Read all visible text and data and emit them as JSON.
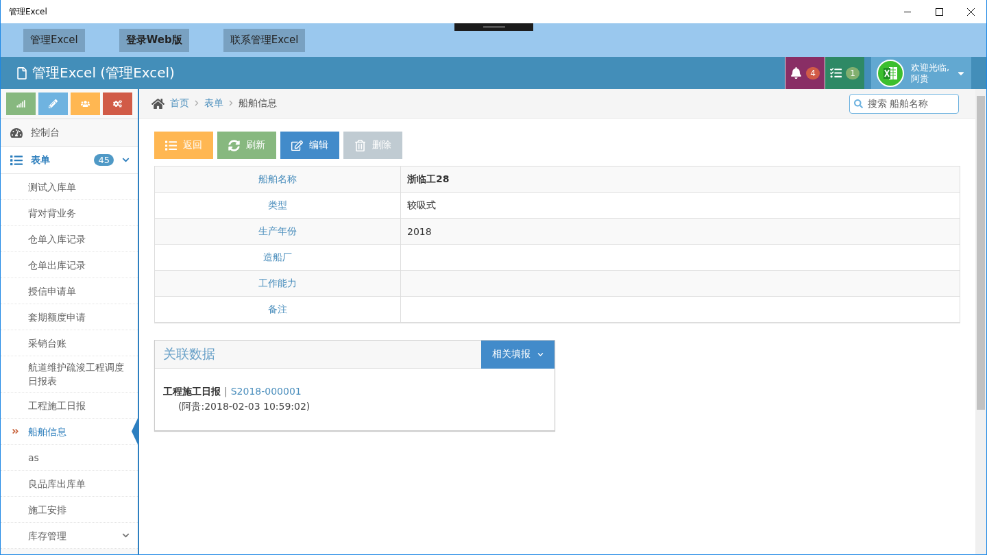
{
  "window": {
    "title": "管理Excel"
  },
  "top_nav": [
    {
      "label": "管理Excel",
      "selected": false
    },
    {
      "label": "登录Web版",
      "selected": true
    },
    {
      "label": "联系管理Excel",
      "selected": false
    }
  ],
  "header": {
    "title": "管理Excel (管理Excel)",
    "notifications": "4",
    "tasks": "1",
    "user": {
      "greeting": "欢迎光临,",
      "name": "阿贵"
    }
  },
  "sidebar": {
    "shortcuts": [
      {
        "kind": "chart",
        "color": "#87b87f"
      },
      {
        "kind": "pencil",
        "color": "#6fb3e0"
      },
      {
        "kind": "users",
        "color": "#ffb752"
      },
      {
        "kind": "cogs",
        "color": "#d15b47"
      }
    ],
    "menu": [
      {
        "label": "控制台",
        "kind": "dashboard",
        "expanded": false
      },
      {
        "label": "表单",
        "kind": "list",
        "badge": "45",
        "expanded": true,
        "children": [
          {
            "label": "测试入库单",
            "kind": "link",
            "selected": false
          },
          {
            "label": "背对背业务",
            "kind": "link",
            "selected": false
          },
          {
            "label": "仓单入库记录",
            "kind": "link",
            "selected": false
          },
          {
            "label": "仓单出库记录",
            "kind": "link",
            "selected": false
          },
          {
            "label": "授信申请单",
            "kind": "link",
            "selected": false
          },
          {
            "label": "套期额度申请",
            "kind": "link",
            "selected": false
          },
          {
            "label": "采销台账",
            "kind": "link",
            "selected": false
          },
          {
            "label": "航道维护疏浚工程调度日报表",
            "kind": "link",
            "selected": false
          },
          {
            "label": "工程施工日报",
            "kind": "link",
            "selected": false
          },
          {
            "label": "船舶信息",
            "kind": "link",
            "selected": true
          },
          {
            "label": "as",
            "kind": "link",
            "selected": false
          },
          {
            "label": "良品库出库单",
            "kind": "link",
            "selected": false
          },
          {
            "label": "施工安排",
            "kind": "link",
            "selected": false
          },
          {
            "label": "库存管理",
            "kind": "folder",
            "selected": false
          }
        ]
      }
    ]
  },
  "breadcrumb": [
    {
      "label": "首页",
      "kind": "home"
    },
    {
      "label": "表单",
      "kind": "link"
    },
    {
      "label": "船舶信息",
      "kind": "current"
    }
  ],
  "search": {
    "placeholder": "搜索 船舶名称"
  },
  "actions": [
    {
      "label": "返回",
      "kind": "back",
      "disabled": false
    },
    {
      "label": "刷新",
      "kind": "refresh",
      "disabled": false
    },
    {
      "label": "编辑",
      "kind": "edit",
      "disabled": false
    },
    {
      "label": "删除",
      "kind": "delete",
      "disabled": true
    }
  ],
  "details": [
    {
      "label": "船舶名称",
      "value": "浙临工28",
      "bold": true
    },
    {
      "label": "类型",
      "value": "较吸式",
      "bold": false
    },
    {
      "label": "生产年份",
      "value": "2018",
      "bold": false
    },
    {
      "label": "造船厂"
    },
    {
      "label": "工作能力"
    },
    {
      "label": "备注"
    }
  ],
  "related": {
    "title": "关联数据",
    "menu_button": "相关填报",
    "entries": [
      {
        "form": "工程施工日报",
        "separator": "|",
        "code": "S2018-000001",
        "meta": "(阿贵:2018-02-03 10:59:02)"
      }
    ]
  }
}
